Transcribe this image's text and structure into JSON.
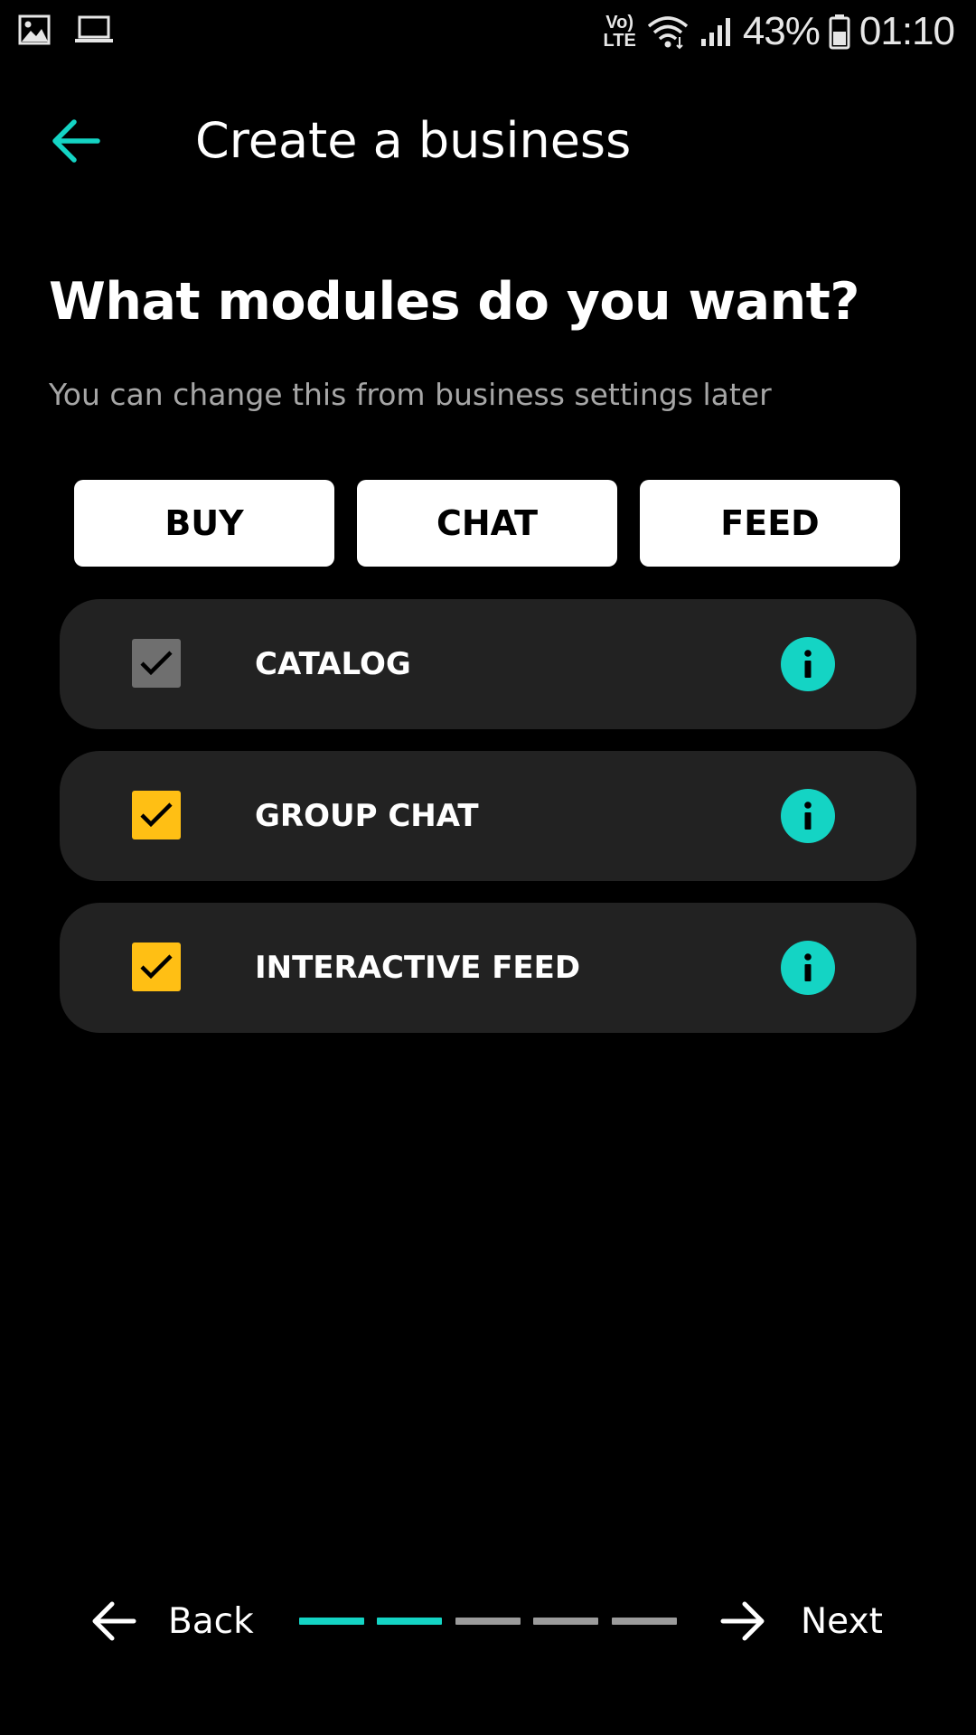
{
  "status_bar": {
    "time": "01:10",
    "battery": "43%",
    "volte_line1": "Vo)",
    "volte_line2": "LTE",
    "icons": [
      "image-icon",
      "laptop-icon",
      "wifi-icon",
      "signal-icon",
      "battery-icon"
    ]
  },
  "header": {
    "title": "Create a business",
    "back_icon": "arrow-left-icon"
  },
  "question": {
    "heading": "What modules do you want?",
    "subtext": "You can change this from business settings later"
  },
  "categories": [
    {
      "label": "BUY"
    },
    {
      "label": "CHAT"
    },
    {
      "label": "FEED"
    }
  ],
  "modules": [
    {
      "label": "CATALOG",
      "checked": true,
      "disabled": true,
      "checkbox_color": "#6f6f6f"
    },
    {
      "label": "GROUP CHAT",
      "checked": true,
      "disabled": false,
      "checkbox_color": "#ffbf14"
    },
    {
      "label": "INTERACTIVE FEED",
      "checked": true,
      "disabled": false,
      "checkbox_color": "#ffbf14"
    }
  ],
  "bottom_nav": {
    "back_label": "Back",
    "next_label": "Next",
    "progress": {
      "total_steps": 5,
      "completed_steps": 2
    }
  },
  "colors": {
    "accent": "#14d4c4",
    "checkbox_active": "#ffbf14",
    "checkbox_disabled": "#6f6f6f",
    "card_bg": "#222222",
    "progress_inactive": "#9b9b9b"
  }
}
